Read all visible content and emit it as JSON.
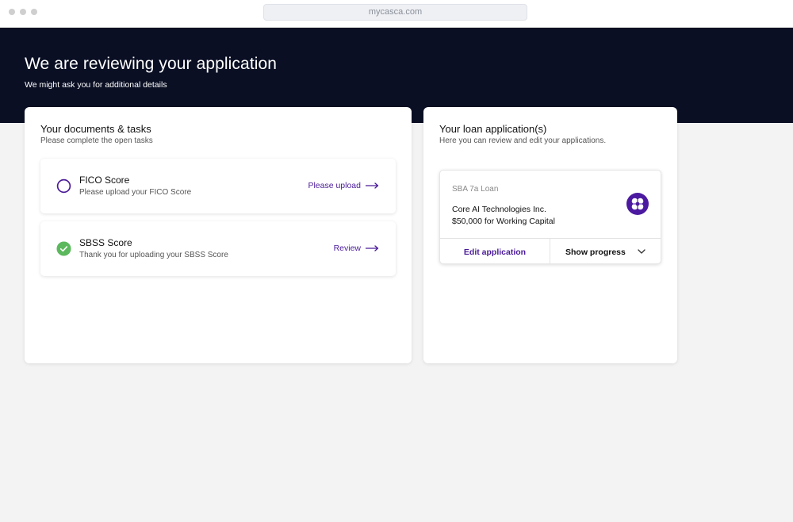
{
  "browser": {
    "url": "mycasca.com"
  },
  "hero": {
    "title": "We are reviewing your application",
    "subtitle": "We might ask you for additional details"
  },
  "documents": {
    "title": "Your documents & tasks",
    "subtitle": "Please complete the open tasks",
    "tasks": [
      {
        "title": "FICO Score",
        "description": "Please upload your FICO Score",
        "status": "open",
        "action": "Please upload"
      },
      {
        "title": "SBSS Score",
        "description": "Thank you for uploading your SBSS Score",
        "status": "complete",
        "action": "Review"
      }
    ]
  },
  "loans": {
    "title": "Your loan application(s)",
    "subtitle": "Here you can review and edit your applications.",
    "applications": [
      {
        "type": "SBA 7a Loan",
        "company": "Core AI Technologies Inc.",
        "amount": "$50,000 for Working Capital",
        "edit_label": "Edit application",
        "progress_label": "Show progress"
      }
    ]
  },
  "colors": {
    "hero_bg": "#0a0f24",
    "accent": "#4a1b99",
    "success": "#5cb85c",
    "logo": "#4b1aa0"
  },
  "icons": {
    "open_task": "empty-circle-icon",
    "done_task": "check-circle-icon",
    "action_arrow": "arrow-right-icon",
    "expand": "chevron-down-icon",
    "company_logo": "clover-logo"
  }
}
